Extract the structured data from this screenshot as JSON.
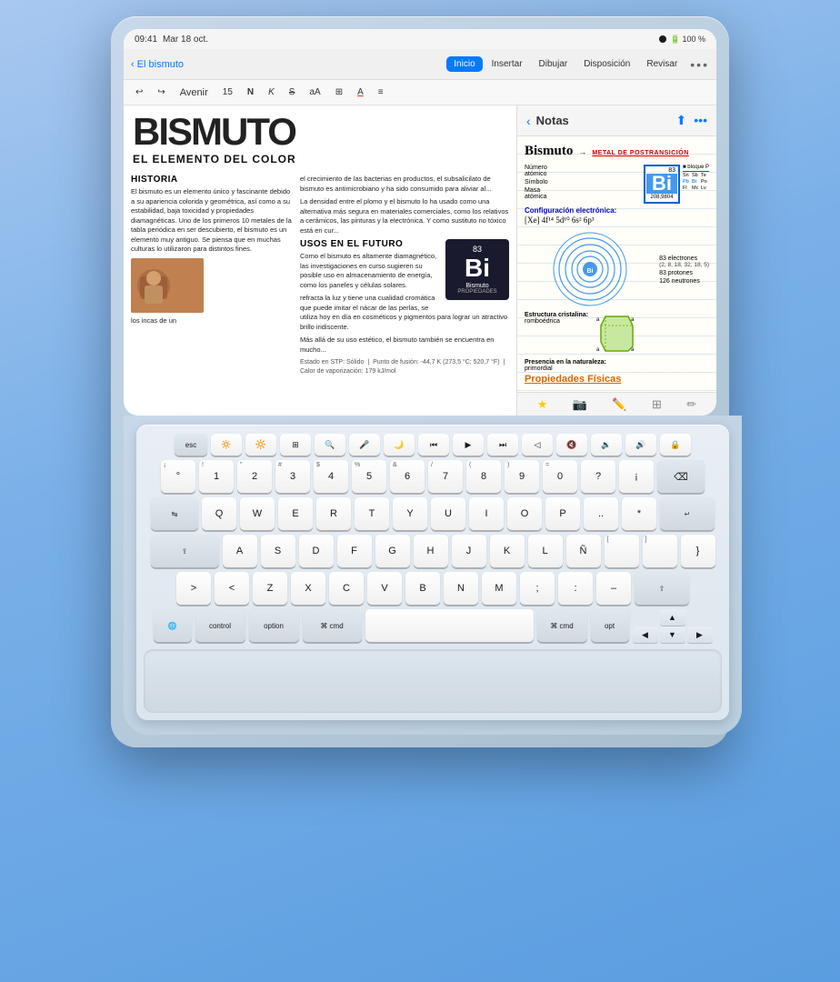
{
  "device": {
    "status_bar": {
      "time": "09:41",
      "date": "Mar 18 oct.",
      "wifi": "100 %",
      "battery_label": "100%"
    }
  },
  "pages_app": {
    "back_label": "El bismuto",
    "toolbar_dots": "•••",
    "tabs": [
      {
        "label": "Inicio",
        "active": true
      },
      {
        "label": "Insertar",
        "active": false
      },
      {
        "label": "Dibujar",
        "active": false
      },
      {
        "label": "Disposición",
        "active": false
      },
      {
        "label": "Revisar",
        "active": false
      }
    ],
    "format_bar": {
      "undo": "↩",
      "redo": "↪",
      "font": "Avenir",
      "size": "15",
      "bold": "N",
      "italic": "K",
      "strike": "S",
      "text_options": "aA",
      "format_options": "⊞",
      "color": "A",
      "list": "≡"
    },
    "article": {
      "big_title": "BISMUTO",
      "subtitle": "EL ELEMENTO DEL COLOR",
      "historia_heading": "HISTORIA",
      "historia_text": "El bismuto es un elemento único y fascinante debido a su apariencia colorida y geométrica, así como a su estabilidad, baja toxicidad y propiedades diamagnéticas. Uno de los primeros 10 metales de la tabla periódica en ser descubierto, el bismuto es un elemento muy antiguo. Se piensa que en muchas culturas lo utilizaron para distintos fines.",
      "usos_heading": "USOS EN EL FUTURO",
      "usos_text": "Como el bismuto es altamente diamagnético, las investigaciones en curso sugieren su posible uso en almacenamiento de energía, como los paneles y células solares.",
      "body_text_1": "el crecimiento de las bacterias en productos, el subsalicilato de bismuto es antimicrobiano y ha sido consumido para aliviar al...",
      "body_text_2": "La densidad entre el plomo y el bismuto lo ha usado como una alternativa más segura en materiales comerciales, como los relativos a cerámicos, las pinturas y la electrónica. Y como sustituto no tóxico está en cur...",
      "body_text_3": "refracta la luz y tiene una cualidad cromática que puede imitar el nácar de las perlas, se utiliza hoy en día en cosméticos y pigmentos para lograr un atractivo brillo iridiscente.",
      "body_text_4": "Más allá de su uso estético, el bismuto también se encuentra en mucho...",
      "estado_label": "Estado en STP:",
      "estado_val": "Sólido",
      "punto_fusion": "Punto de fusión: -44,7 K (273,5 °C; 520,7 °F)",
      "calor_vaporizacion": "Calor de vaporización: 179 kJ/mol",
      "element_number": "83",
      "element_symbol": "Bi",
      "element_name": "Bismuto",
      "element_sub": "PROPIEDADES"
    }
  },
  "notes_app": {
    "header": {
      "back_label": "Notas",
      "dots": "•••"
    },
    "content": {
      "title": "Bismuto",
      "metal_label": "METAL DE POSTRANSICIÓN",
      "table": {
        "rows": [
          {
            "label": "Número atómico",
            "value": "83"
          },
          {
            "label": "Símbolo",
            "value": ""
          },
          {
            "label": "Masa atómica",
            "value": "208,9804"
          }
        ],
        "symbol": "Bi",
        "periodic_group": "bloque P",
        "right_elements": "Sn Sb Te\nPb Bi Po\nFl Mc Lv"
      },
      "config_heading": "Configuración electrónica:",
      "config_value": "[Xe] 4f¹⁴ 5d¹⁰ 6s² 6p³",
      "electrons_83": "83 electrones",
      "orbits": "(2, 8, 18, 32, 18, 5)",
      "protons_83": "83 protones",
      "neutrones_126": "126 neutrones",
      "crystal_heading": "Estructura cristalina:",
      "crystal_type": "romboédrica",
      "nature_heading": "Presencia en la naturaleza:",
      "nature_val": "primordial",
      "propiedades_heading": "Propiedades Físicas"
    }
  },
  "keyboard": {
    "rows": [
      {
        "keys": [
          {
            "label": "esc",
            "type": "modifier fn-row"
          },
          {
            "label": "☀",
            "type": "fn fn-row"
          },
          {
            "label": "☀☀",
            "type": "fn fn-row"
          },
          {
            "label": "⊞",
            "type": "fn fn-row"
          },
          {
            "label": "🔍",
            "type": "fn fn-row"
          },
          {
            "label": "🎤",
            "type": "fn fn-row"
          },
          {
            "label": "🌙",
            "type": "fn fn-row"
          },
          {
            "label": "⏮",
            "type": "fn fn-row"
          },
          {
            "label": "▶",
            "type": "fn fn-row"
          },
          {
            "label": "⏭",
            "type": "fn fn-row"
          },
          {
            "label": "◁",
            "type": "fn fn-row"
          },
          {
            "label": "🔇",
            "type": "fn fn-row"
          },
          {
            "label": "🔉",
            "type": "fn fn-row"
          },
          {
            "label": "🔊",
            "type": "fn fn-row"
          },
          {
            "label": "🔒",
            "type": "fn fn-row"
          }
        ]
      },
      {
        "keys": [
          {
            "label": "°",
            "sub": "¡",
            "type": "standard"
          },
          {
            "label": "1",
            "sub": "!",
            "type": "standard"
          },
          {
            "label": "2",
            "sub": "\"",
            "type": "standard"
          },
          {
            "label": "3",
            "sub": "#",
            "type": "standard"
          },
          {
            "label": "4",
            "sub": "$",
            "type": "standard"
          },
          {
            "label": "5",
            "sub": "%",
            "type": "standard"
          },
          {
            "label": "6",
            "sub": "&",
            "type": "standard"
          },
          {
            "label": "7",
            "sub": "/",
            "type": "standard"
          },
          {
            "label": "8",
            "sub": "(",
            "type": "standard"
          },
          {
            "label": "9",
            "sub": ")",
            "type": "standard"
          },
          {
            "label": "0",
            "sub": "=",
            "type": "standard"
          },
          {
            "label": "?",
            "sub": "",
            "type": "standard"
          },
          {
            "label": "¡",
            "sub": "",
            "type": "standard"
          },
          {
            "label": "⌫",
            "type": "backspace"
          }
        ]
      },
      {
        "keys": [
          {
            "label": "↹",
            "type": "wide modifier"
          },
          {
            "label": "Q",
            "type": "standard"
          },
          {
            "label": "W",
            "type": "standard"
          },
          {
            "label": "E",
            "type": "standard"
          },
          {
            "label": "R",
            "type": "standard"
          },
          {
            "label": "T",
            "type": "standard"
          },
          {
            "label": "Y",
            "type": "standard"
          },
          {
            "label": "U",
            "type": "standard"
          },
          {
            "label": "I",
            "type": "standard"
          },
          {
            "label": "O",
            "type": "standard"
          },
          {
            "label": "P",
            "type": "standard"
          },
          {
            "label": "..",
            "type": "standard"
          },
          {
            "label": "*",
            "type": "standard"
          },
          {
            "label": "↵",
            "type": "return modifier"
          }
        ]
      },
      {
        "keys": [
          {
            "label": "⇪",
            "type": "caps modifier"
          },
          {
            "label": "A",
            "type": "standard"
          },
          {
            "label": "S",
            "type": "standard"
          },
          {
            "label": "D",
            "type": "standard"
          },
          {
            "label": "F",
            "type": "standard"
          },
          {
            "label": "G",
            "type": "standard"
          },
          {
            "label": "H",
            "type": "standard"
          },
          {
            "label": "J",
            "type": "standard"
          },
          {
            "label": "K",
            "type": "standard"
          },
          {
            "label": "L",
            "type": "standard"
          },
          {
            "label": "Ñ",
            "type": "standard"
          },
          {
            "label": "[",
            "type": "standard"
          },
          {
            "label": "]",
            "type": "standard"
          },
          {
            "label": "}",
            "type": "standard"
          }
        ]
      },
      {
        "keys": [
          {
            "label": ">",
            "type": "standard"
          },
          {
            "label": "<",
            "type": "standard"
          },
          {
            "label": "Z",
            "type": "standard"
          },
          {
            "label": "X",
            "type": "standard"
          },
          {
            "label": "C",
            "type": "standard"
          },
          {
            "label": "V",
            "type": "standard"
          },
          {
            "label": "B",
            "type": "standard"
          },
          {
            "label": "N",
            "type": "standard"
          },
          {
            "label": "M",
            "type": "standard"
          },
          {
            "label": ";",
            "type": "standard"
          },
          {
            "label": ":",
            "type": "standard"
          },
          {
            "label": "-",
            "type": "standard"
          },
          {
            "label": "⇧",
            "type": "shift-right modifier"
          }
        ]
      },
      {
        "keys": [
          {
            "label": "🌐",
            "type": "modifier extra-wide"
          },
          {
            "label": "control",
            "type": "modifier wide"
          },
          {
            "label": "option",
            "type": "modifier wide"
          },
          {
            "label": "⌘ cmd",
            "type": "modifier extra-wide"
          },
          {
            "label": "",
            "type": "space"
          },
          {
            "label": "⌘ cmd",
            "type": "modifier wide"
          },
          {
            "label": "opt",
            "type": "modifier"
          },
          {
            "label": "◀",
            "type": "arrow"
          },
          {
            "label": "▲",
            "type": "arrow"
          },
          {
            "label": "▼",
            "type": "arrow"
          },
          {
            "label": "▶",
            "type": "arrow"
          }
        ]
      }
    ]
  }
}
